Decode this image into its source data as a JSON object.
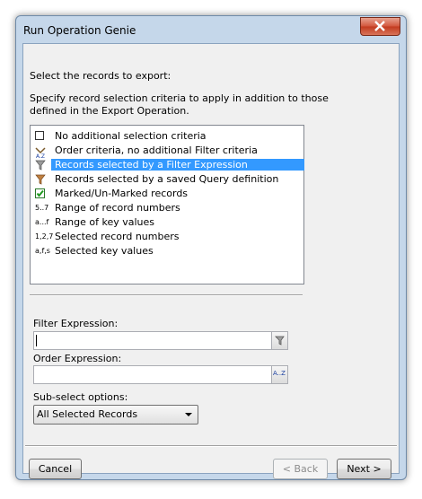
{
  "window": {
    "title": "Run Operation Genie"
  },
  "main": {
    "heading": "Select the records to export:",
    "description_line1": "Specify record selection criteria to apply in addition to those",
    "description_line2": "defined in the Export Operation."
  },
  "criteria": {
    "items": [
      {
        "icon": "checkbox-empty-icon",
        "label": "No additional selection criteria",
        "selected": false
      },
      {
        "icon": "sort-az-icon",
        "label": "Order criteria, no additional Filter criteria",
        "selected": false
      },
      {
        "icon": "filter-icon",
        "label": "Records selected by a Filter Expression",
        "selected": true
      },
      {
        "icon": "saved-query-filter-icon",
        "label": "Records selected by a saved Query definition",
        "selected": false
      },
      {
        "icon": "checkbox-checked-icon",
        "label": "Marked/Un-Marked records",
        "selected": false
      },
      {
        "icon_text": "5..7",
        "label": "Range of record numbers",
        "selected": false
      },
      {
        "icon_text": "a...f",
        "label": "Range of key values",
        "selected": false
      },
      {
        "icon_text": "1,2,7",
        "label": "Selected record numbers",
        "selected": false
      },
      {
        "icon_text": "a,f,s",
        "label": "Selected key values",
        "selected": false
      }
    ]
  },
  "filter": {
    "label": "Filter Expression:",
    "value": ""
  },
  "order": {
    "label": "Order Expression:",
    "value": "",
    "button_text": "A..Z"
  },
  "subselect": {
    "label": "Sub-select options:",
    "value": "All Selected Records"
  },
  "buttons": {
    "cancel": "Cancel",
    "back": "< Back",
    "next": "Next >"
  },
  "colors": {
    "selection": "#3399ff",
    "client_bg": "#f0f0f0",
    "frame": "#c5d7ea"
  }
}
